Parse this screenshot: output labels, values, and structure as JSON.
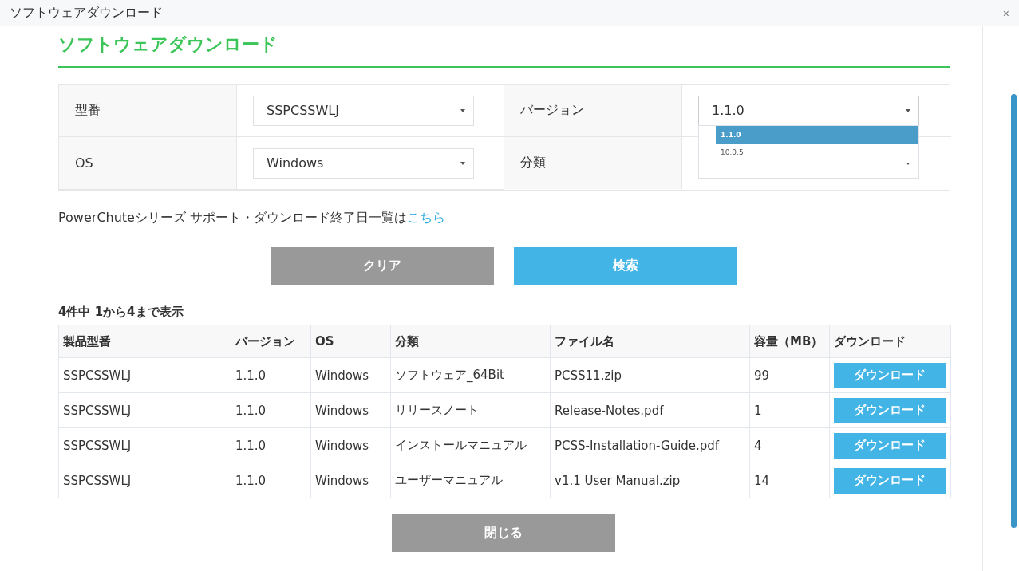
{
  "window": {
    "title": "ソフトウェアダウンロード",
    "close": "×"
  },
  "heading": "ソフトウェアダウンロード",
  "form": {
    "fields": [
      {
        "label": "型番",
        "value": "SSPCSSWLJ",
        "expanded": false
      },
      {
        "label": "バージョン",
        "value": "1.1.0",
        "expanded": true,
        "options": [
          {
            "label": "1.1.0",
            "selected": true
          },
          {
            "label": "10.0.5",
            "selected": false
          }
        ]
      },
      {
        "label": "OS",
        "value": "Windows",
        "expanded": false
      },
      {
        "label": "分類",
        "expanded": false
      }
    ]
  },
  "notice": {
    "text": "PowerChuteシリーズ サポート・ダウンロード終了日一覧は",
    "link": "こちら"
  },
  "buttons": [
    {
      "label": "クリア",
      "kind": "secondary"
    },
    {
      "label": "検索",
      "kind": "primary"
    }
  ],
  "results": {
    "summary": "4件中 1から4まで表示",
    "columns": [
      "製品型番",
      "バージョン",
      "OS",
      "分類",
      "ファイル名",
      "容量（MB）",
      "ダウンロード"
    ],
    "rows": [
      {
        "cells": [
          "SSPCSSWLJ",
          "1.1.0",
          "Windows",
          "ソフトウェア_64Bit",
          "PCSS11.zip",
          "99"
        ],
        "action": "ダウンロード"
      },
      {
        "cells": [
          "SSPCSSWLJ",
          "1.1.0",
          "Windows",
          "リリースノート",
          "Release-Notes.pdf",
          "1"
        ],
        "action": "ダウンロード"
      },
      {
        "cells": [
          "SSPCSSWLJ",
          "1.1.0",
          "Windows",
          "インストールマニュアル",
          "PCSS-Installation-Guide.pdf",
          "4"
        ],
        "action": "ダウンロード"
      },
      {
        "cells": [
          "SSPCSSWLJ",
          "1.1.0",
          "Windows",
          "ユーザーマニュアル",
          "v1.1 User Manual.zip",
          "14"
        ],
        "action": "ダウンロード"
      }
    ]
  },
  "close_button": "閉じる"
}
